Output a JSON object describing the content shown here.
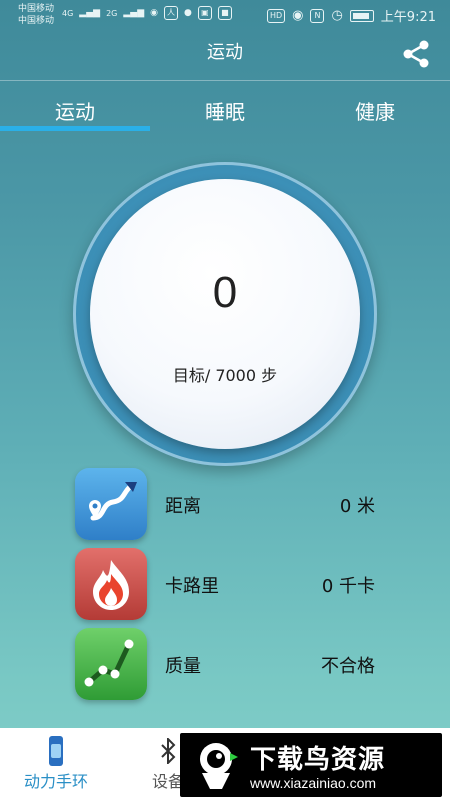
{
  "statusbar": {
    "carrier1": "中国移动",
    "carrier2": "中国移动",
    "net1": "4G",
    "net2": "2G",
    "hd": "HD",
    "time": "上午9:21"
  },
  "header": {
    "title": "运动",
    "share_icon": "share-icon"
  },
  "tabs": [
    {
      "label": "运动",
      "active": true
    },
    {
      "label": "睡眠",
      "active": false
    },
    {
      "label": "健康",
      "active": false
    }
  ],
  "dial": {
    "steps": "0",
    "goal_text": "目标/ 7000 步"
  },
  "stats": [
    {
      "icon": "route-icon",
      "label": "距离",
      "value": "0 米",
      "color": "#3c93d8"
    },
    {
      "icon": "flame-icon",
      "label": "卡路里",
      "value": "0 千卡",
      "color": "#d9534f"
    },
    {
      "icon": "trend-icon",
      "label": "质量",
      "value": "不合格",
      "color": "#3fb24a"
    }
  ],
  "navbar": {
    "items": [
      {
        "icon": "band-icon",
        "label": "动力手环",
        "active": true
      },
      {
        "icon": "bluetooth-icon",
        "label": "设备",
        "active": false
      }
    ]
  },
  "watermark": {
    "title": "下载鸟资源",
    "url": "www.xiazainiao.com"
  },
  "colors": {
    "accent": "#2ab0e8",
    "nav_active": "#2a8fc6"
  }
}
